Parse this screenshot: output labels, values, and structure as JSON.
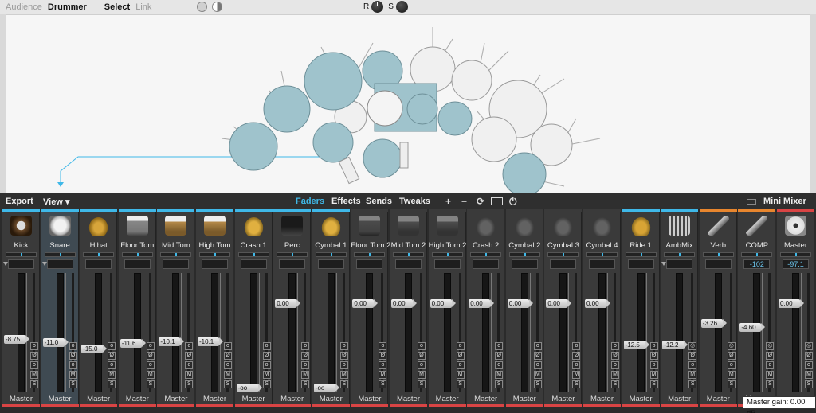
{
  "topbar": {
    "items": [
      {
        "label": "Audience",
        "active": false
      },
      {
        "label": "Drummer",
        "active": true
      },
      {
        "label": "Select",
        "active": true
      },
      {
        "label": "Link",
        "active": false
      }
    ],
    "info_icon": "i",
    "knob_r_label": "R",
    "knob_s_label": "S"
  },
  "toolbar": {
    "export_label": "Export",
    "view_label": "View ▾",
    "tabs": [
      "Faders",
      "Effects",
      "Sends",
      "Tweaks"
    ],
    "add_label": "+",
    "remove_label": "−",
    "refresh_label": "⟳",
    "power_label": "⏻",
    "mini_mixer_label": "Mini Mixer"
  },
  "channels": [
    {
      "name": "Kick",
      "value": "-8.75",
      "level": 0.44,
      "icon": "kick-drum-icon",
      "bar": "#3fb8e8",
      "out": "Master",
      "type": "normal"
    },
    {
      "name": "Snare",
      "value": "-11.0",
      "level": 0.41,
      "icon": "snare-drum-icon",
      "bar": "#3fb8e8",
      "out": "Master",
      "type": "normal",
      "selected": true
    },
    {
      "name": "Hihat",
      "value": "-15.0",
      "level": 0.35,
      "icon": "hihat-icon",
      "bar": "#3fb8e8",
      "out": "Master",
      "type": "normal"
    },
    {
      "name": "Floor Tom",
      "value": "-11.6",
      "level": 0.4,
      "icon": "floor-tom-icon",
      "bar": "#3fb8e8",
      "out": "Master",
      "type": "normal"
    },
    {
      "name": "Mid Tom",
      "value": "-10.1",
      "level": 0.42,
      "icon": "mid-tom-icon",
      "bar": "#3fb8e8",
      "out": "Master",
      "type": "normal"
    },
    {
      "name": "High Tom",
      "value": "-10.1",
      "level": 0.42,
      "icon": "high-tom-icon",
      "bar": "#3fb8e8",
      "out": "Master",
      "type": "normal"
    },
    {
      "name": "Crash 1",
      "value": "-oo",
      "level": 0.0,
      "icon": "crash-cymbal-icon",
      "bar": "#3fb8e8",
      "out": "Master",
      "type": "normal"
    },
    {
      "name": "Perc",
      "value": "0.00",
      "level": 0.76,
      "icon": "perc-pad-icon",
      "bar": "#3fb8e8",
      "out": "Master",
      "type": "normal"
    },
    {
      "name": "Cymbal 1",
      "value": "-oo",
      "level": 0.0,
      "icon": "cymbal-icon",
      "bar": "#3fb8e8",
      "out": "Master",
      "type": "normal"
    },
    {
      "name": "Floor Tom 2",
      "value": "0.00",
      "level": 0.76,
      "icon": "floor-tom-icon",
      "bar": "#3a3a3a",
      "out": "Master",
      "type": "normal"
    },
    {
      "name": "Mid Tom 2",
      "value": "0.00",
      "level": 0.76,
      "icon": "mid-tom-icon",
      "bar": "#3a3a3a",
      "out": "Master",
      "type": "normal"
    },
    {
      "name": "High Tom 2",
      "value": "0.00",
      "level": 0.76,
      "icon": "high-tom-icon",
      "bar": "#3a3a3a",
      "out": "Master",
      "type": "normal"
    },
    {
      "name": "Crash 2",
      "value": "0.00",
      "level": 0.76,
      "icon": "crash-cymbal-icon",
      "bar": "#3a3a3a",
      "out": "Master",
      "type": "normal"
    },
    {
      "name": "Cymbal 2",
      "value": "0.00",
      "level": 0.76,
      "icon": "cymbal-icon",
      "bar": "#3a3a3a",
      "out": "Master",
      "type": "normal"
    },
    {
      "name": "Cymbal 3",
      "value": "0.00",
      "level": 0.76,
      "icon": "cymbal-icon",
      "bar": "#3a3a3a",
      "out": "Master",
      "type": "normal"
    },
    {
      "name": "Cymbal 4",
      "value": "0.00",
      "level": 0.76,
      "icon": "cymbal-icon",
      "bar": "#3a3a3a",
      "out": "Master",
      "type": "normal"
    },
    {
      "name": "Ride 1",
      "value": "-12.5",
      "level": 0.39,
      "icon": "ride-cymbal-icon",
      "bar": "#3fb8e8",
      "out": "Master",
      "type": "normal"
    },
    {
      "name": "AmbMix",
      "value": "-12.2",
      "level": 0.39,
      "icon": "ambience-mixer-icon",
      "bar": "#3fb8e8",
      "out": "Master",
      "type": "bus"
    },
    {
      "name": "Verb",
      "value": "-3.26",
      "level": 0.58,
      "icon": "reverb-icon",
      "bar": "#e8862e",
      "out": "Master",
      "type": "bus"
    },
    {
      "name": "COMP",
      "value": "-4.60",
      "peak": "-102",
      "level": 0.55,
      "icon": "compressor-icon",
      "bar": "#e8862e",
      "out": "Master",
      "type": "bus"
    },
    {
      "name": "Master",
      "value": "0.00",
      "peak": "-97.1",
      "level": 0.76,
      "icon": "master-reel-icon",
      "bar": "#d94444",
      "out": "",
      "type": "master"
    }
  ],
  "tooltip": "Master gain: 0.00 dB",
  "colors": {
    "accent": "#3fb8e8",
    "drum_fill": "#9fc3cc",
    "output_red": "#d94444",
    "fx_orange": "#e8862e"
  }
}
